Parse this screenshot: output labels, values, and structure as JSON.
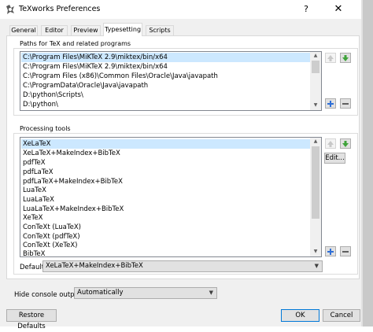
{
  "window": {
    "title": "TeXworks Preferences",
    "help_label": "?",
    "close_label": "✕"
  },
  "tabs": [
    {
      "label": "General"
    },
    {
      "label": "Editor"
    },
    {
      "label": "Preview"
    },
    {
      "label": "Typesetting"
    },
    {
      "label": "Scripts"
    }
  ],
  "paths": {
    "group_label": "Paths for TeX and related programs",
    "items": [
      "C:\\Program Files\\MiKTeX 2.9\\miktex/bin/x64",
      "C:\\Program Files\\MiKTeX 2.9\\miktex/bin/x64",
      "C:\\Program Files (x86)\\Common Files\\Oracle\\Java\\javapath",
      "C:\\ProgramData\\Oracle\\Java\\javapath",
      "D:\\python\\Scripts\\",
      "D:\\python\\"
    ],
    "selected_index": 0
  },
  "tools": {
    "group_label": "Processing tools",
    "items": [
      "XeLaTeX",
      "XeLaTeX+MakeIndex+BibTeX",
      "pdfTeX",
      "pdfLaTeX",
      "pdfLaTeX+MakeIndex+BibTeX",
      "LuaTeX",
      "LuaLaTeX",
      "LuaLaTeX+MakeIndex+BibTeX",
      "XeTeX",
      "ConTeXt (LuaTeX)",
      "ConTeXt (pdfTeX)",
      "ConTeXt (XeTeX)",
      "BibTeX"
    ],
    "selected_index": 0,
    "edit_label": "Edit...",
    "default_label": "Default:",
    "default_value": "XeLaTeX+MakeIndex+BibTeX"
  },
  "console": {
    "label": "Hide console output:",
    "value": "Automatically"
  },
  "footer": {
    "restore_label": "Restore Defaults",
    "ok_label": "OK",
    "cancel_label": "Cancel"
  },
  "colors": {
    "selection": "#cce8ff",
    "arrow_green": "#3fa33a",
    "plus_blue": "#2f6fd6"
  }
}
